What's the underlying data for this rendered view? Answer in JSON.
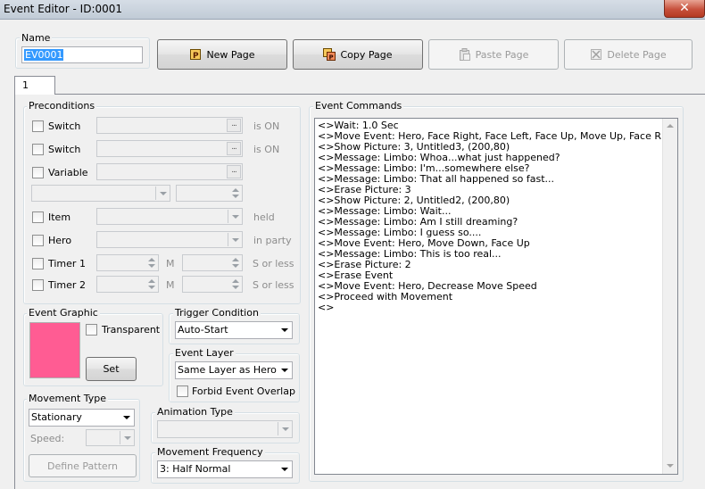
{
  "window": {
    "title": "Event Editor - ID:0001",
    "close_label": "✕"
  },
  "name_group": {
    "label": "Name",
    "value": "EV0001"
  },
  "toolbar": {
    "new_page": "New Page",
    "copy_page": "Copy Page",
    "paste_page": "Paste Page",
    "delete_page": "Delete Page"
  },
  "tabs": [
    {
      "label": "1"
    }
  ],
  "preconditions": {
    "label": "Preconditions",
    "switch1": {
      "label": "Switch",
      "suffix": "is ON",
      "value": ""
    },
    "switch2": {
      "label": "Switch",
      "suffix": "is ON",
      "value": ""
    },
    "variable": {
      "label": "Variable",
      "value": ""
    },
    "item": {
      "label": "Item",
      "suffix": "held"
    },
    "hero": {
      "label": "Hero",
      "suffix": "in party"
    },
    "timer1": {
      "label": "Timer 1",
      "unit": "M",
      "suffix": "S or less"
    },
    "timer2": {
      "label": "Timer 2",
      "unit": "M",
      "suffix": "S or less"
    }
  },
  "event_graphic": {
    "label": "Event Graphic",
    "transparent_label": "Transparent",
    "set_button": "Set",
    "preview_color": "#ff5c93"
  },
  "trigger": {
    "label": "Trigger Condition",
    "value": "Auto-Start"
  },
  "event_layer": {
    "label": "Event Layer",
    "value": "Same Layer as Hero",
    "forbid_overlap_label": "Forbid Event Overlap"
  },
  "movement_type": {
    "label": "Movement Type",
    "value": "Stationary",
    "speed_label": "Speed:",
    "define_pattern": "Define Pattern"
  },
  "animation_type": {
    "label": "Animation Type",
    "value": ""
  },
  "movement_frequency": {
    "label": "Movement Frequency",
    "value": "3: Half Normal"
  },
  "event_commands": {
    "label": "Event Commands",
    "lines": [
      "<>Wait: 1.0 Sec",
      "<>Move Event: Hero, Face Right, Face Left, Face Up, Move Up, Face Right,",
      "<>Show Picture: 3, Untitled3, (200,80)",
      "<>Message: Limbo: Whoa...what just happened?",
      "<>Message: Limbo: I'm...somewhere else?",
      "<>Message: Limbo: That all happened so fast...",
      "<>Erase Picture: 3",
      "<>Show Picture: 2, Untitled2, (200,80)",
      "<>Message: Limbo: Wait...",
      "<>Message: Limbo: Am I still dreaming?",
      "<>Message: Limbo: I guess so....",
      "<>Move Event: Hero, Move Down, Face Up",
      "<>Message: Limbo: This is too real...",
      "<>Erase Picture: 2",
      "<>Erase Event",
      "<>Move Event: Hero, Decrease Move Speed",
      "<>Proceed with Movement",
      "<>"
    ]
  }
}
